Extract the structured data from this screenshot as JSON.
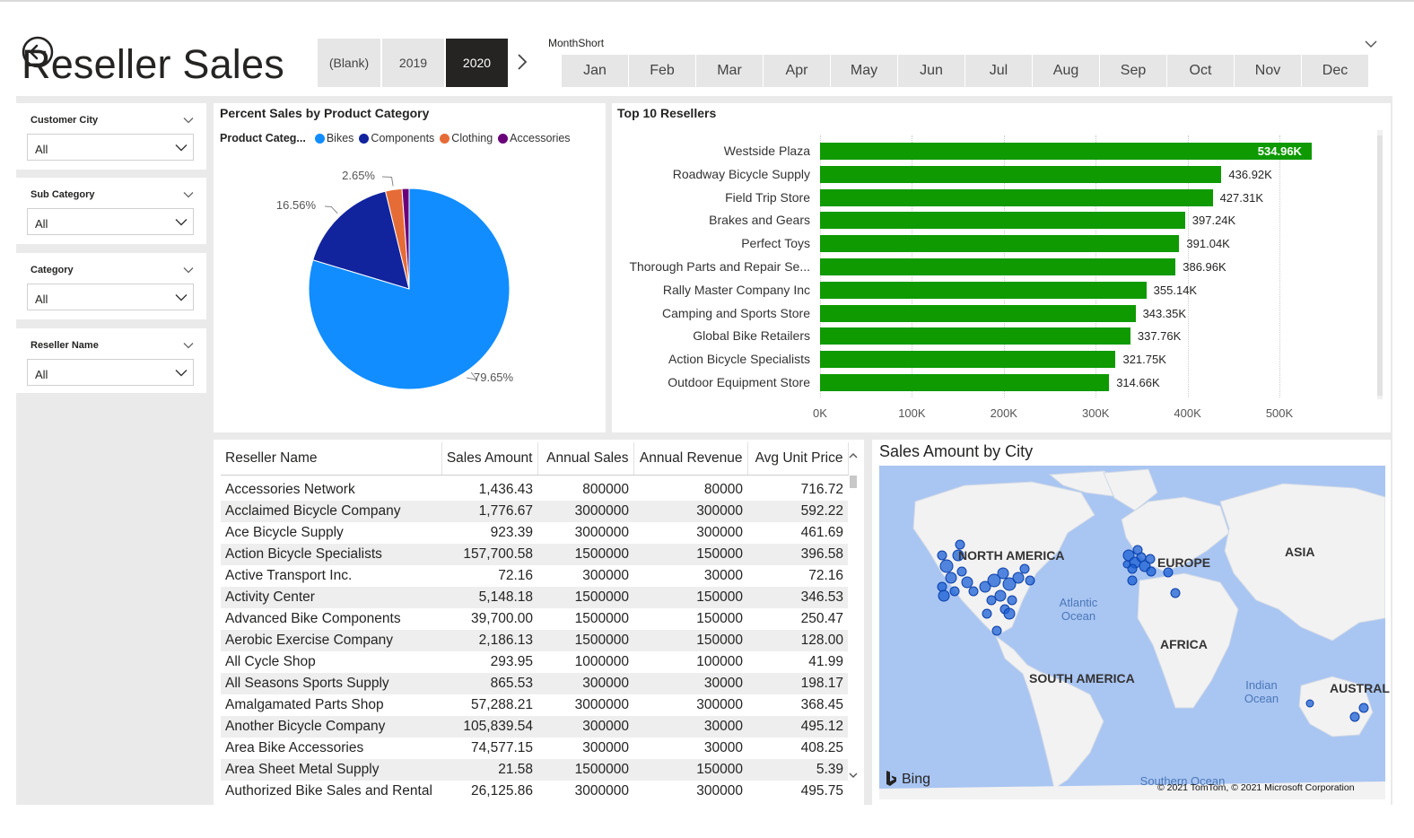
{
  "page": {
    "title": "Reseller Sales"
  },
  "year_slicer": {
    "options": [
      {
        "label": "(Blank)",
        "active": false
      },
      {
        "label": "2019",
        "active": false
      },
      {
        "label": "2020",
        "active": true
      }
    ]
  },
  "month_slicer": {
    "label": "MonthShort",
    "months": [
      "Jan",
      "Feb",
      "Mar",
      "Apr",
      "May",
      "Jun",
      "Jul",
      "Aug",
      "Sep",
      "Oct",
      "Nov",
      "Dec"
    ]
  },
  "filters": [
    {
      "title": "Customer City",
      "value": "All"
    },
    {
      "title": "Sub Category",
      "value": "All"
    },
    {
      "title": "Category",
      "value": "All"
    },
    {
      "title": "Reseller Name",
      "value": "All"
    }
  ],
  "pie_panel": {
    "title": "Percent Sales by Product Category",
    "legend_title": "Product Categ...",
    "chart_data": {
      "type": "pie",
      "slices": [
        {
          "name": "Bikes",
          "percent": 79.65,
          "label": "79.65%",
          "color": "#118dff"
        },
        {
          "name": "Components",
          "percent": 16.56,
          "label": "16.56%",
          "color": "#12239e"
        },
        {
          "name": "Clothing",
          "percent": 2.65,
          "label": "2.65%",
          "color": "#e66c37"
        },
        {
          "name": "Accessories",
          "percent": 1.14,
          "label": "",
          "color": "#6b007b"
        }
      ]
    }
  },
  "bar_panel": {
    "title": "Top 10 Resellers",
    "chart_data": {
      "type": "bar",
      "orientation": "horizontal",
      "categories": [
        "Westside Plaza",
        "Roadway Bicycle Supply",
        "Field Trip Store",
        "Brakes and Gears",
        "Perfect Toys",
        "Thorough Parts and Repair Se...",
        "Rally Master Company Inc",
        "Camping and Sports Store",
        "Global Bike Retailers",
        "Action Bicycle Specialists",
        "Outdoor Equipment Store"
      ],
      "values": [
        534960,
        436920,
        427310,
        397240,
        391040,
        386960,
        355140,
        343350,
        337760,
        321750,
        314660
      ],
      "value_labels": [
        "534.96K",
        "436.92K",
        "427.31K",
        "397.24K",
        "391.04K",
        "386.96K",
        "355.14K",
        "343.35K",
        "337.76K",
        "321.75K",
        "314.66K"
      ],
      "xlim": [
        0,
        500000
      ],
      "x_ticks": [
        "0K",
        "100K",
        "200K",
        "300K",
        "400K",
        "500K"
      ],
      "bar_color": "#0e9a00"
    }
  },
  "table": {
    "headers": [
      "Reseller Name",
      "Sales Amount",
      "Annual Sales",
      "Annual Revenue",
      "Avg Unit Price"
    ],
    "rows": [
      [
        "Accessories Network",
        "1,436.43",
        "800000",
        "80000",
        "716.72"
      ],
      [
        "Acclaimed Bicycle Company",
        "1,776.67",
        "3000000",
        "300000",
        "592.22"
      ],
      [
        "Ace Bicycle Supply",
        "923.39",
        "3000000",
        "300000",
        "461.69"
      ],
      [
        "Action Bicycle Specialists",
        "157,700.58",
        "1500000",
        "150000",
        "396.58"
      ],
      [
        "Active Transport Inc.",
        "72.16",
        "300000",
        "30000",
        "72.16"
      ],
      [
        "Activity Center",
        "5,148.18",
        "1500000",
        "150000",
        "346.53"
      ],
      [
        "Advanced Bike Components",
        "39,700.00",
        "1500000",
        "150000",
        "250.47"
      ],
      [
        "Aerobic Exercise Company",
        "2,186.13",
        "1500000",
        "150000",
        "128.00"
      ],
      [
        "All Cycle Shop",
        "293.95",
        "1000000",
        "100000",
        "41.99"
      ],
      [
        "All Seasons Sports Supply",
        "865.53",
        "300000",
        "30000",
        "198.17"
      ],
      [
        "Amalgamated Parts Shop",
        "57,288.21",
        "3000000",
        "300000",
        "368.45"
      ],
      [
        "Another Bicycle Company",
        "105,839.54",
        "300000",
        "30000",
        "495.12"
      ],
      [
        "Area Bike Accessories",
        "74,577.15",
        "300000",
        "30000",
        "408.25"
      ],
      [
        "Area Sheet Metal Supply",
        "21.58",
        "1500000",
        "150000",
        "5.39"
      ],
      [
        "Authorized Bike Sales and Rental",
        "26,125.86",
        "3000000",
        "300000",
        "495.75"
      ]
    ]
  },
  "map_panel": {
    "title": "Sales Amount by City",
    "continents": [
      "NORTH AMERICA",
      "EUROPE",
      "ASIA",
      "AFRICA",
      "SOUTH AMERICA",
      "AUSTRAL"
    ],
    "oceans": [
      "Atlantic\nOcean",
      "Indian\nOcean",
      "Southern Ocean"
    ],
    "attribution_logo": "Bing",
    "attribution": "© 2021 TomTom, © 2021 Microsoft Corporation"
  },
  "colors": {
    "accent_dark": "#252423",
    "bar_green": "#0e9a00",
    "map_water": "#a9c5f2",
    "map_land": "#f2f2f2",
    "map_bubble": "#1a5fd6"
  }
}
